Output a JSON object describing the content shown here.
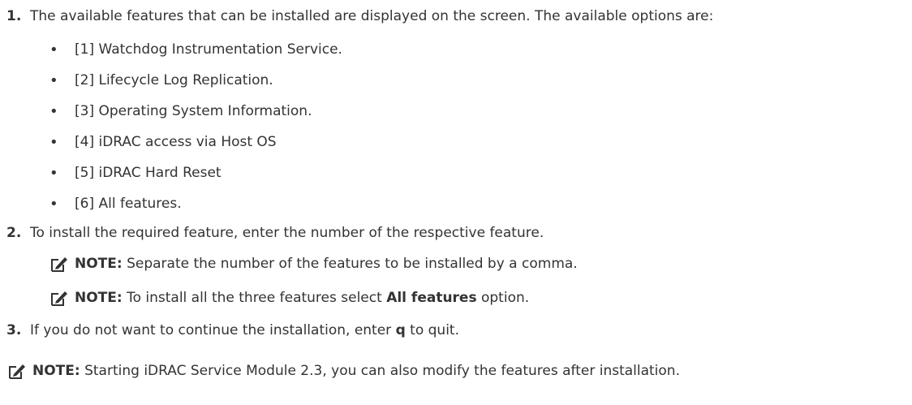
{
  "steps": [
    {
      "number": "1.",
      "text": "The available features that can be installed are displayed on the screen. The available options are:",
      "options": [
        "[1] Watchdog Instrumentation Service.",
        "[2] Lifecycle Log Replication.",
        "[3] Operating System Information.",
        "[4] iDRAC access via Host OS",
        "[5] iDRAC Hard Reset",
        "[6] All features."
      ]
    },
    {
      "number": "2.",
      "text": "To install the required feature, enter the number of the respective feature.",
      "notes": [
        {
          "label": "NOTE:",
          "text": " Separate the number of the features to be installed by a comma."
        },
        {
          "label": "NOTE:",
          "text_before": " To install all the three features select ",
          "bold": "All features",
          "text_after": " option."
        }
      ]
    },
    {
      "number": "3.",
      "text_before": "If you do not want to continue the installation, enter ",
      "bold": "q",
      "text_after": " to quit."
    }
  ],
  "final_note": {
    "label": "NOTE:",
    "text": " Starting iDRAC Service Module 2.3, you can also modify the features after installation."
  },
  "icon": "note-pencil-icon",
  "bullet_char": "•"
}
